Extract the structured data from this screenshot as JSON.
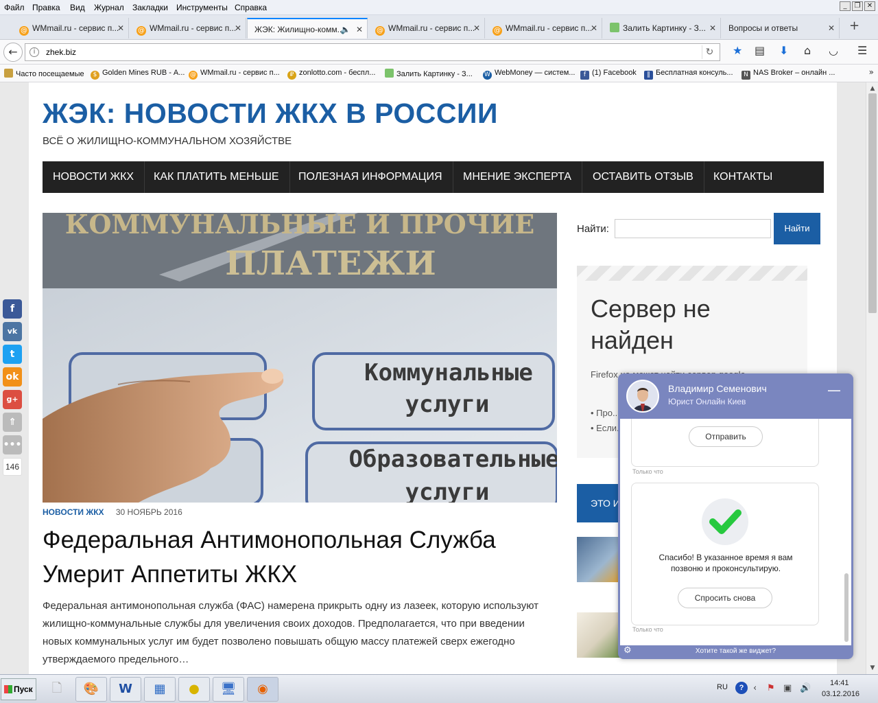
{
  "menubar": [
    "Файл",
    "Правка",
    "Вид",
    "Журнал",
    "Закладки",
    "Инструменты",
    "Справка"
  ],
  "tabs": [
    {
      "label": "WMmail.ru - сервис п...",
      "icon": "wmmail-icon"
    },
    {
      "label": "WMmail.ru - сервис п...",
      "icon": "wmmail-icon"
    },
    {
      "label": "ЖЭК: Жилищно-комм...",
      "icon": "none",
      "active": true
    },
    {
      "label": "WMmail.ru - сервис п...",
      "icon": "wmmail-icon"
    },
    {
      "label": "WMmail.ru - сервис п...",
      "icon": "wmmail-icon"
    },
    {
      "label": "Залить Картинку - З...",
      "icon": "image-icon"
    },
    {
      "label": "Вопросы и ответы",
      "icon": "none"
    }
  ],
  "address": {
    "url": "zhek.biz"
  },
  "bookmarks": [
    "Часто посещаемые",
    "Golden Mines RUB - А...",
    "WMmail.ru - сервис п...",
    "zonlotto.com - беспл...",
    "Залить Картинку - З...",
    "WebMoney — систем...",
    "(1) Facebook",
    "Бесплатная консуль...",
    "NAS Broker – онлайн ..."
  ],
  "site": {
    "title": "ЖЭК: НОВОСТИ ЖКХ В РОССИИ",
    "tagline": "ВСЁ О ЖИЛИЩНО-КОММУНАЛЬНОМ ХОЗЯЙСТВЕ",
    "nav": [
      "НОВОСТИ ЖКХ",
      "КАК ПЛАТИТЬ МЕНЬШЕ",
      "ПОЛЕЗНАЯ ИНФОРМАЦИЯ",
      "МНЕНИЕ ЭКСПЕРТА",
      "ОСТАВИТЬ ОТЗЫВ",
      "КОНТАКТЫ"
    ],
    "hero": {
      "sign_top": "КОММУНАЛЬНЫЕ И ПРОЧИЕ",
      "sign_main": "ПЛАТЕЖИ",
      "button1_l1": "Коммунальные",
      "button1_l2": "услуги",
      "button2_l1": "Образовательные",
      "button2_l2": "услуги"
    },
    "post": {
      "category": "НОВОСТИ ЖКХ",
      "date": "30 НОЯБРЬ 2016",
      "title": "Федеральная Антимонопольная Служба Умерит Аппетиты ЖКХ",
      "excerpt": "Федеральная антимонопольная служба (ФАС) намерена прикрыть одну из лазеек, которую используют жилищно-коммунальные службы для увеличения своих доходов. Предполагается, что при введении новых коммунальных услуг им будет позволено повышать общую массу платежей сверх ежегодно утверждаемого предельного…"
    },
    "search": {
      "label": "Найти:",
      "button": "Найти"
    },
    "error_widget": {
      "title": "Сервер не найден",
      "text": "Firefox не может найти сервер google...",
      "items": [
        "Про... набо... вме...",
        "Если..."
      ]
    },
    "blue_header": "ЭТО И..."
  },
  "share": {
    "count": "146"
  },
  "chat": {
    "name": "Владимир Семенович",
    "role": "Юрист Онлайн Киев",
    "send": "Отправить",
    "time1": "Только что",
    "thanks": "Спасибо! В указанное время я вам позвоню и проконсультирую.",
    "ask_again": "Спросить снова",
    "time2": "Только что",
    "footer": "Хотите такой же виджет?"
  },
  "taskbar": {
    "start": "Пуск",
    "lang": "RU",
    "time": "14:41",
    "date": "03.12.2016"
  },
  "colors": {
    "brand": "#1b5ea4",
    "nav_bg": "#222222",
    "chat": "#7a86bf"
  }
}
